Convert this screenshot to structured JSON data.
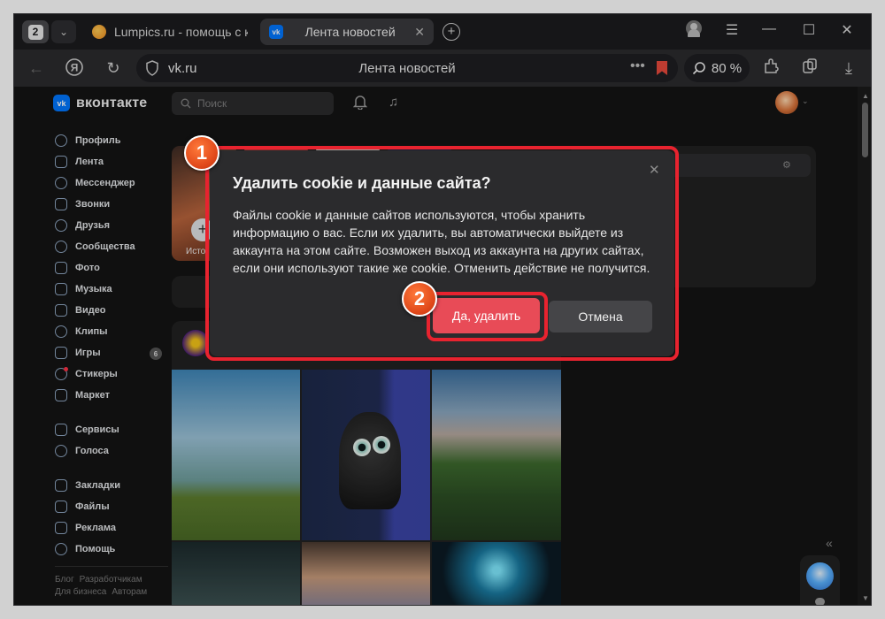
{
  "browser": {
    "tab_count": "2",
    "tabs": [
      {
        "title": "Lumpics.ru - помощь с ко"
      },
      {
        "title": "Лента новостей"
      }
    ],
    "url_host": "vk.ru",
    "page_title": "Лента новостей",
    "zoom": "80 %"
  },
  "vk": {
    "logo_text": "вконтакте",
    "search_placeholder": "Поиск",
    "sidebar": [
      {
        "label": "Профиль"
      },
      {
        "label": "Лента"
      },
      {
        "label": "Мессенджер"
      },
      {
        "label": "Звонки"
      },
      {
        "label": "Друзья"
      },
      {
        "label": "Сообщества"
      },
      {
        "label": "Фото"
      },
      {
        "label": "Музыка"
      },
      {
        "label": "Видео"
      },
      {
        "label": "Клипы"
      },
      {
        "label": "Игры",
        "badge": "6"
      },
      {
        "label": "Стикеры"
      },
      {
        "label": "Маркет"
      },
      {
        "label": "Сервисы"
      },
      {
        "label": "Голоса"
      },
      {
        "label": "Закладки"
      },
      {
        "label": "Файлы"
      },
      {
        "label": "Реклама"
      },
      {
        "label": "Помощь"
      }
    ],
    "footer_links": [
      "Блог",
      "Разработчикам",
      "Для бизнеса",
      "Авторам"
    ],
    "story_label": "Исто"
  },
  "dialog": {
    "title": "Удалить cookie и данные сайта?",
    "body": "Файлы cookie и данные сайтов используются, чтобы хранить информацию о вас. Если их удалить, вы автоматически выйдете из аккаунта на этом сайте. Возможен выход из аккаунта на других сайтах, если они используют такие же cookie. Отменить действие не получится.",
    "confirm_label": "Да, удалить",
    "cancel_label": "Отмена"
  },
  "annotations": {
    "step1": "1",
    "step2": "2",
    "highlight_color": "#e8232f",
    "marker_color": "#e0481a"
  },
  "colors": {
    "accent_vk": "#0077ff",
    "confirm_button": "#e84b57"
  }
}
